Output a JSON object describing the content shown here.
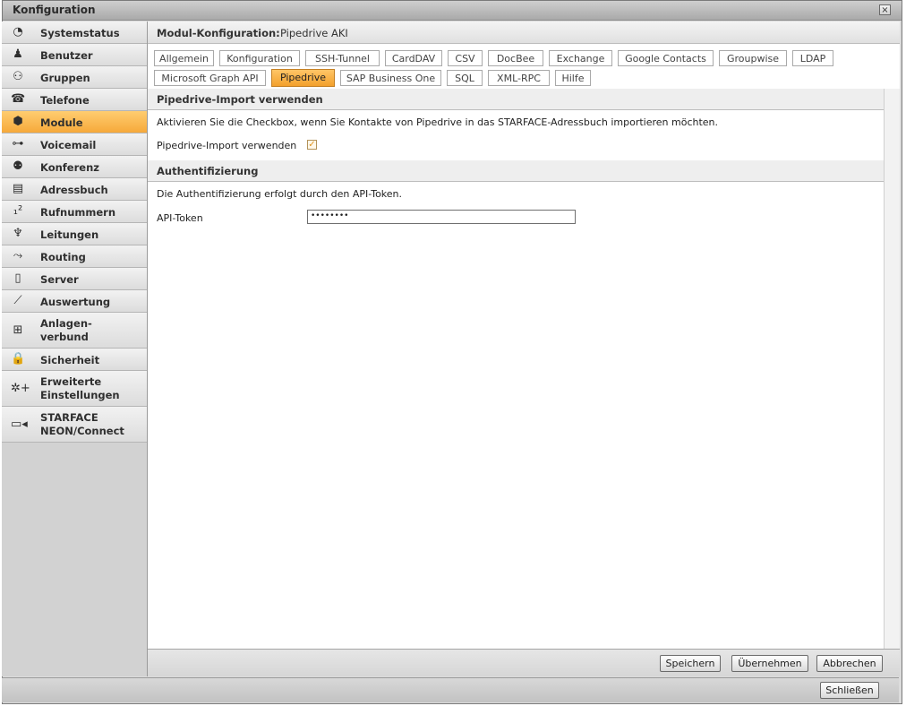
{
  "window": {
    "title": "Konfiguration",
    "close_glyph": "×"
  },
  "sidebar": {
    "items": [
      {
        "label": "Systemstatus",
        "icon": "◔"
      },
      {
        "label": "Benutzer",
        "icon": "♟"
      },
      {
        "label": "Gruppen",
        "icon": "⚇"
      },
      {
        "label": "Telefone",
        "icon": "☎"
      },
      {
        "label": "Module",
        "icon": "⬢"
      },
      {
        "label": "Voicemail",
        "icon": "⊶"
      },
      {
        "label": "Konferenz",
        "icon": "⚉"
      },
      {
        "label": "Adressbuch",
        "icon": "▤"
      },
      {
        "label": "Rufnummern",
        "icon": "₁²"
      },
      {
        "label": "Leitungen",
        "icon": "♆"
      },
      {
        "label": "Routing",
        "icon": "⤳"
      },
      {
        "label": "Server",
        "icon": "▯"
      },
      {
        "label": "Auswertung",
        "icon": "⟋"
      },
      {
        "label": "Anlagen-\nverbund",
        "icon": "⊞"
      },
      {
        "label": "Sicherheit",
        "icon": "🔒"
      },
      {
        "label": "Erweiterte\nEinstellungen",
        "icon": "✲+"
      },
      {
        "label": "STARFACE\nNEON/Connect",
        "icon": "▭◂"
      }
    ],
    "active": "Module"
  },
  "module_header": {
    "key": "Modul-Konfiguration:",
    "value": "Pipedrive AKI"
  },
  "tabs": {
    "row1": [
      "Allgemein",
      "Konfiguration",
      "SSH-Tunnel",
      "CardDAV",
      "CSV",
      "DocBee",
      "Exchange",
      "Google Contacts",
      "Groupwise",
      "LDAP"
    ],
    "row2": [
      "Microsoft Graph API",
      "Pipedrive",
      "SAP Business One",
      "SQL",
      "XML-RPC",
      "Hilfe"
    ],
    "active": "Pipedrive"
  },
  "import_section": {
    "title": "Pipedrive-Import verwenden",
    "description": "Aktivieren Sie die Checkbox, wenn Sie Kontakte von Pipedrive in das STARFACE-Adressbuch importieren möchten.",
    "checkbox_label": "Pipedrive-Import verwenden",
    "checked": true
  },
  "auth_section": {
    "title": "Authentifizierung",
    "description": "Die Authentifizierung erfolgt durch den API-Token.",
    "token_label": "API-Token",
    "token_value": "••••••••"
  },
  "footer": {
    "save": "Speichern",
    "apply": "Übernehmen",
    "cancel": "Abbrechen"
  },
  "bottom": {
    "close": "Schließen"
  },
  "colors": {
    "accent": "#f6a93a",
    "panel": "#dcdcdc"
  }
}
